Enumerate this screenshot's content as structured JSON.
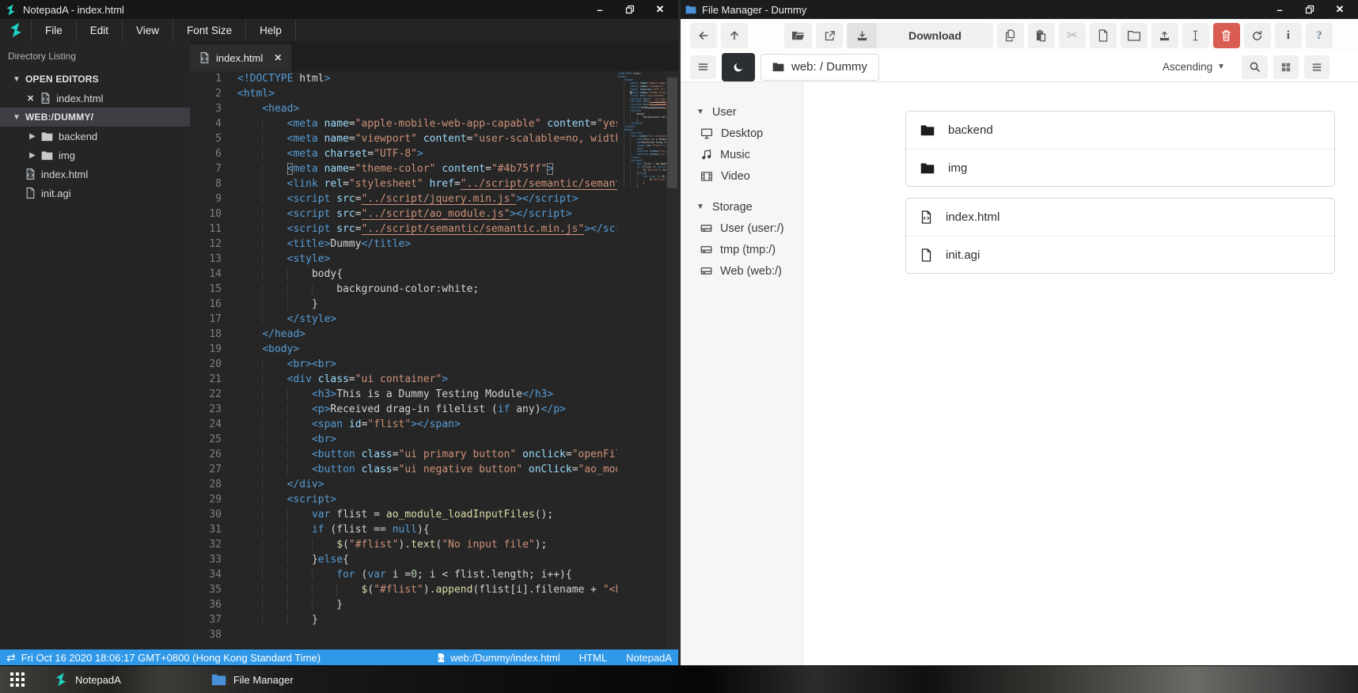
{
  "colors": {
    "accent_status_blue": "#2f98e8",
    "brand_teal": "#1fd1c4",
    "delete_red": "#d95c52",
    "folder_blue": "#4a90d9",
    "editor_theme_color_literal": "#4b75ff"
  },
  "notepad": {
    "window_title": "NotepadA - index.html",
    "menu": [
      "File",
      "Edit",
      "View",
      "Font Size",
      "Help"
    ],
    "sidebar": {
      "header": "Directory Listing",
      "open_editors_label": "OPEN EDITORS",
      "open_editors": [
        {
          "name": "index.html"
        }
      ],
      "workspace_label": "WEB:/DUMMY/",
      "tree": [
        {
          "name": "backend",
          "type": "folder"
        },
        {
          "name": "img",
          "type": "folder"
        },
        {
          "name": "index.html",
          "type": "html-file"
        },
        {
          "name": "init.agi",
          "type": "file"
        }
      ]
    },
    "tab": {
      "name": "index.html"
    },
    "cursor_line": 7,
    "code_lines": [
      "<!DOCTYPE html>",
      "<html>",
      "    <head>",
      "        <meta name=\"apple-mobile-web-app-capable\" content=\"yes\">",
      "        <meta name=\"viewport\" content=\"user-scalable=no, width=device-width\">",
      "        <meta charset=\"UTF-8\">",
      "        <meta name=\"theme-color\" content=\"#4b75ff\">",
      "        <link rel=\"stylesheet\" href=\"../script/semantic/semantic.min.css\">",
      "        <script src=\"../script/jquery.min.js\"></script>",
      "        <script src=\"../script/ao_module.js\"></script>",
      "        <script src=\"../script/semantic/semantic.min.js\"></script>",
      "        <title>Dummy</title>",
      "        <style>",
      "            body{",
      "                background-color:white;",
      "            }",
      "        </style>",
      "    </head>",
      "    <body>",
      "        <br><br>",
      "        <div class=\"ui container\">",
      "            <h3>This is a Dummy Testing Module</h3>",
      "            <p>Received drag-in filelist (if any)</p>",
      "            <span id=\"flist\"></span>",
      "            <br>",
      "            <button class=\"ui primary button\" onclick=\"openFileSelector()\">Open</button>",
      "            <button class=\"ui negative button\" onClick=\"ao_module_close();\">Close</button>",
      "        </div>",
      "        <script>",
      "            var flist = ao_module_loadInputFiles();",
      "            if (flist == null){",
      "                $(\"#flist\").text(\"No input file\");",
      "            }else{",
      "                for (var i =0; i < flist.length; i++){",
      "                    $(\"#flist\").append(flist[i].filename + \"<br>\");",
      "                }",
      "            }",
      ""
    ],
    "statusbar": {
      "datetime": "Fri Oct 16 2020 18:06:17 GMT+0800 (Hong Kong Standard Time)",
      "file_path": "web:/Dummy/index.html",
      "language": "HTML",
      "app_name": "NotepadA"
    }
  },
  "filemanager": {
    "window_title": "File Manager - Dummy",
    "toolbar": {
      "download_label": "Download",
      "breadcrumb": "web: / Dummy",
      "sort_label": "Ascending",
      "icons_row1": [
        "back-icon",
        "up-icon",
        "open-folder-icon",
        "open-external-icon",
        "download-icon",
        "copy-icon",
        "paste-icon",
        "cut-icon",
        "new-file-icon",
        "new-folder-icon",
        "upload-icon",
        "text-cursor-icon",
        "trash-icon",
        "refresh-icon",
        "info-icon",
        "help-icon"
      ],
      "icons_row2": [
        "hamburger-icon",
        "moon-icon",
        "folder-icon",
        "caret-down-icon",
        "search-icon",
        "grid-view-icon",
        "list-view-icon"
      ]
    },
    "sidebar": {
      "sections": [
        {
          "label": "User",
          "items": [
            {
              "label": "Desktop",
              "icon": "desktop-icon"
            },
            {
              "label": "Music",
              "icon": "music-icon"
            },
            {
              "label": "Video",
              "icon": "video-icon"
            }
          ]
        },
        {
          "label": "Storage",
          "items": [
            {
              "label": "User (user:/)",
              "icon": "drive-icon"
            },
            {
              "label": "tmp (tmp:/)",
              "icon": "drive-icon"
            },
            {
              "label": "Web (web:/)",
              "icon": "drive-icon"
            }
          ]
        }
      ]
    },
    "files": {
      "folders": [
        {
          "name": "backend"
        },
        {
          "name": "img"
        }
      ],
      "files": [
        {
          "name": "index.html",
          "icon": "html-file-icon"
        },
        {
          "name": "init.agi",
          "icon": "file-icon"
        }
      ]
    }
  },
  "taskbar": {
    "items": [
      {
        "label": "NotepadA"
      },
      {
        "label": "File Manager"
      }
    ]
  }
}
